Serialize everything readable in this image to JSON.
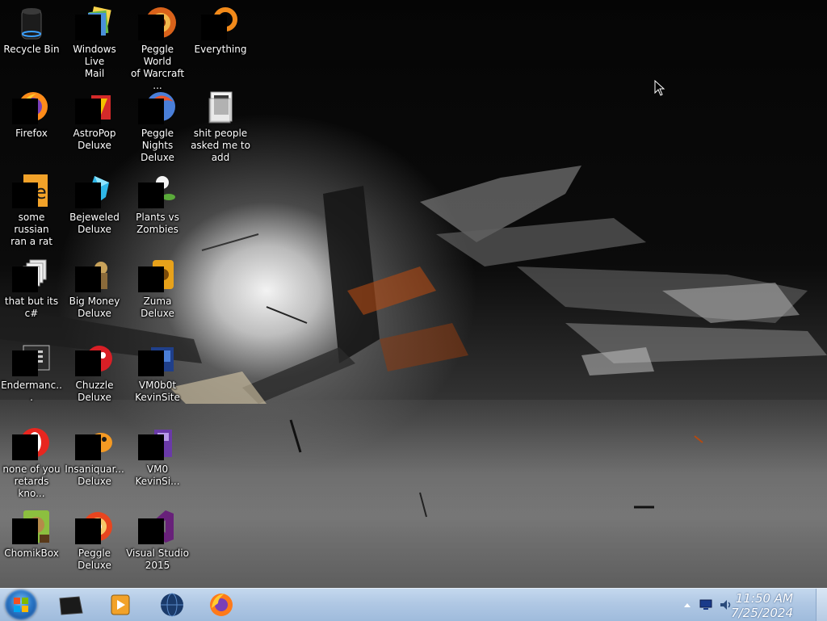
{
  "desktop": {
    "icons": [
      {
        "name": "recycle-bin",
        "label": "Recycle Bin",
        "icon": "recycle-bin-icon"
      },
      {
        "name": "windows-live-mail",
        "label": "Windows Live\nMail",
        "icon": "mail-icon"
      },
      {
        "name": "peggle-world-of-warcraft",
        "label": "Peggle World\nof Warcraft ...",
        "icon": "peggle-icon"
      },
      {
        "name": "everything",
        "label": "Everything",
        "icon": "search-icon"
      },
      {
        "name": "firefox",
        "label": "Firefox",
        "icon": "firefox-icon"
      },
      {
        "name": "astropop-deluxe",
        "label": "AstroPop\nDeluxe",
        "icon": "astropop-icon"
      },
      {
        "name": "peggle-nights-deluxe",
        "label": "Peggle Nights\nDeluxe",
        "icon": "peggle-nights-icon"
      },
      {
        "name": "folder-stuff",
        "label": "shit people\nasked me to\nadd",
        "icon": "folder-icon"
      },
      {
        "name": "some-russian-ran-a-rat",
        "label": "some russian\nran a rat",
        "icon": "executable-icon"
      },
      {
        "name": "bejeweled-deluxe",
        "label": "Bejeweled\nDeluxe",
        "icon": "gem-icon"
      },
      {
        "name": "plants-vs-zombies",
        "label": "Plants vs\nZombies",
        "icon": "plant-icon"
      },
      {
        "name": "that-but-its-csharp",
        "label": "that but its c#",
        "icon": "files-icon"
      },
      {
        "name": "big-money-deluxe",
        "label": "Big Money\nDeluxe",
        "icon": "money-icon"
      },
      {
        "name": "zuma-deluxe",
        "label": "Zuma Deluxe",
        "icon": "zuma-icon"
      },
      {
        "name": "endermanch",
        "label": "Endermanc...",
        "icon": "window-app-icon"
      },
      {
        "name": "chuzzle-deluxe",
        "label": "Chuzzle\nDeluxe",
        "icon": "chuzzle-icon"
      },
      {
        "name": "vm0b0t-kevinsite",
        "label": "VM0b0t\nKevinSite",
        "icon": "vm-icon"
      },
      {
        "name": "none-of-you-retards",
        "label": "none of you\nretards kno...",
        "icon": "opera-icon"
      },
      {
        "name": "insaniquarium",
        "label": "Insaniquar...\nDeluxe",
        "icon": "fish-icon"
      },
      {
        "name": "vm0-kevinsite",
        "label": "VM0\nKevinSi...",
        "icon": "vm-folder-icon"
      },
      {
        "name": "chomikbox",
        "label": "ChomikBox",
        "icon": "hamster-icon"
      },
      {
        "name": "peggle-deluxe",
        "label": "Peggle Deluxe",
        "icon": "peggle-deluxe-icon"
      },
      {
        "name": "visual-studio-2015",
        "label": "Visual Studio\n2015",
        "icon": "visual-studio-icon"
      }
    ]
  },
  "taskbar": {
    "start_icon": "windows-start-icon",
    "pinned": [
      {
        "name": "taskbar-app-1",
        "icon": "black-box-icon"
      },
      {
        "name": "taskbar-app-media-player",
        "icon": "media-player-icon"
      },
      {
        "name": "taskbar-app-globe",
        "icon": "globe-icon"
      },
      {
        "name": "taskbar-app-firefox",
        "icon": "firefox-icon"
      }
    ],
    "clock": {
      "time": "11:50 AM",
      "date": "7/25/2024"
    }
  },
  "colors": {
    "taskbar": "#b0c8e4",
    "label_text": "#ffffff"
  }
}
